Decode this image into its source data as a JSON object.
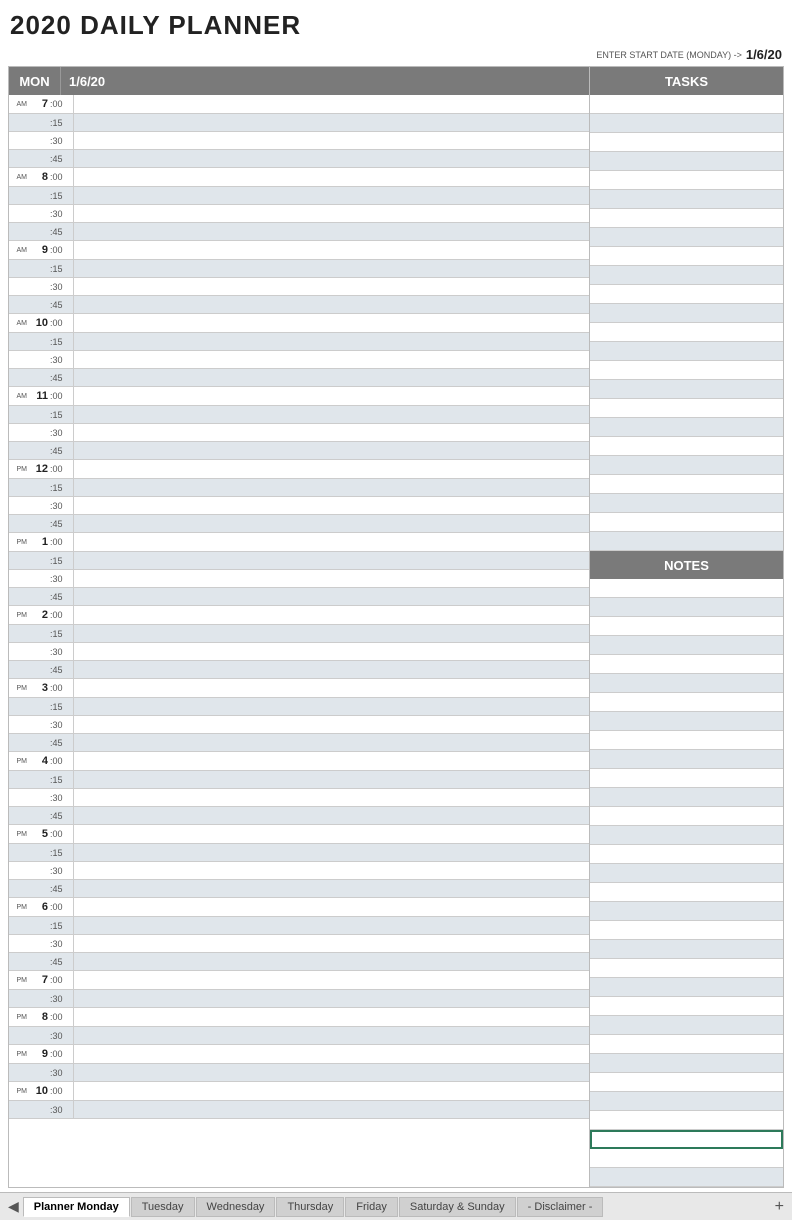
{
  "header": {
    "title": "2020 DAILY PLANNER",
    "start_date_label": "ENTER START DATE (MONDAY) ->",
    "start_date_value": "1/6/20"
  },
  "schedule": {
    "day": "MON",
    "date": "1/6/20",
    "tasks_label": "TASKS",
    "notes_label": "NOTES",
    "hours": [
      {
        "hour": "7",
        "ampm": "AM",
        "slots": [
          ":00",
          ":15",
          ":30",
          ":45"
        ]
      },
      {
        "hour": "8",
        "ampm": "AM",
        "slots": [
          ":00",
          ":15",
          ":30",
          ":45"
        ]
      },
      {
        "hour": "9",
        "ampm": "AM",
        "slots": [
          ":00",
          ":15",
          ":30",
          ":45"
        ]
      },
      {
        "hour": "10",
        "ampm": "AM",
        "slots": [
          ":00",
          ":15",
          ":30",
          ":45"
        ]
      },
      {
        "hour": "11",
        "ampm": "AM",
        "slots": [
          ":00",
          ":15",
          ":30",
          ":45"
        ]
      },
      {
        "hour": "12",
        "ampm": "PM",
        "slots": [
          ":00",
          ":15",
          ":30",
          ":45"
        ]
      },
      {
        "hour": "1",
        "ampm": "PM",
        "slots": [
          ":00",
          ":15",
          ":30",
          ":45"
        ]
      },
      {
        "hour": "2",
        "ampm": "PM",
        "slots": [
          ":00",
          ":15",
          ":30",
          ":45"
        ]
      },
      {
        "hour": "3",
        "ampm": "PM",
        "slots": [
          ":00",
          ":15",
          ":30",
          ":45"
        ]
      },
      {
        "hour": "4",
        "ampm": "PM",
        "slots": [
          ":00",
          ":15",
          ":30",
          ":45"
        ]
      },
      {
        "hour": "5",
        "ampm": "PM",
        "slots": [
          ":00",
          ":15",
          ":30",
          ":45"
        ]
      },
      {
        "hour": "6",
        "ampm": "PM",
        "slots": [
          ":00",
          ":15",
          ":30",
          ":45"
        ]
      },
      {
        "hour": "7",
        "ampm": "PM",
        "slots": [
          ":00",
          ":30"
        ]
      },
      {
        "hour": "8",
        "ampm": "PM",
        "slots": [
          ":00",
          ":30"
        ]
      },
      {
        "hour": "9",
        "ampm": "PM",
        "slots": [
          ":00",
          ":30"
        ]
      },
      {
        "hour": "10",
        "ampm": "PM",
        "slots": [
          ":00",
          ":30"
        ]
      }
    ]
  },
  "tabs": {
    "arrow_left": "◀",
    "arrow_right": "▶",
    "items": [
      {
        "label": "Planner Monday",
        "active": true
      },
      {
        "label": "Tuesday",
        "active": false
      },
      {
        "label": "Wednesday",
        "active": false
      },
      {
        "label": "Thursday",
        "active": false
      },
      {
        "label": "Friday",
        "active": false
      },
      {
        "label": "Saturday & Sunday",
        "active": false
      },
      {
        "label": "- Disclaimer -",
        "active": false
      }
    ],
    "add_button": "+"
  }
}
